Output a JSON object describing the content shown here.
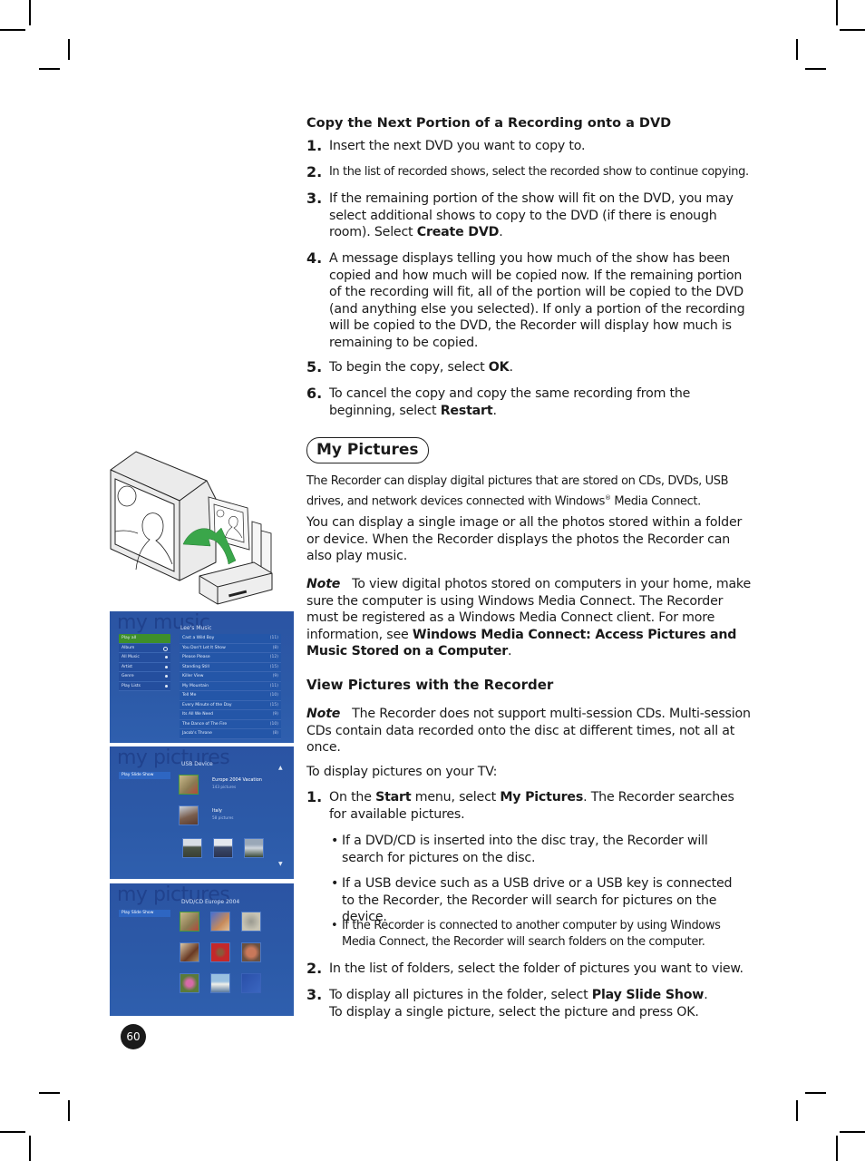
{
  "section1": {
    "heading": "Copy the Next Portion of a Recording onto a DVD",
    "steps": [
      {
        "num": "1.",
        "text": "Insert the next DVD you want to copy to."
      },
      {
        "num": "2.",
        "text": "In the list of recorded shows, select the recorded show to continue copying."
      },
      {
        "num": "3.",
        "text_a": "If the remaining portion of the show will fit on the DVD, you may select additional shows to copy to the DVD (if there is enough room). Select ",
        "bold": "Create DVD",
        "text_b": "."
      },
      {
        "num": "4.",
        "text": "A message displays telling you how much of the show has been copied and how much will be copied now. If the remaining portion of the recording will fit, all of the portion will be copied to the DVD (and anything else you selected). If only a portion of the recording will be copied to the DVD, the Recorder will display how much is remaining to be copied."
      },
      {
        "num": "5.",
        "text_a": "To begin the copy, select ",
        "bold": "OK",
        "text_b": "."
      },
      {
        "num": "6.",
        "text_a": "To cancel the copy and copy the same recording from the beginning, select ",
        "bold": "Restart",
        "text_b": "."
      }
    ]
  },
  "section2": {
    "title": "My Pictures",
    "intro_a": "The Recorder can display digital pictures that are stored on CDs, DVDs, USB drives, and network devices connected with Windows",
    "intro_reg": "®",
    "intro_b": " Media Connect.",
    "para2": "You can display a single image or all the photos stored within a folder or device. When the Recorder displays the photos the Recorder can also play music.",
    "note1_label": "Note",
    "note1_text": "To view digital photos stored on computers in your home, make sure the computer is using Windows Media Connect. The Recorder must be registered as a Windows Media Connect client. For more information, see ",
    "note1_bold": "Windows Media Connect: Access Pictures and Music Stored on a Computer",
    "note1_end": ".",
    "subheading": "View Pictures with the Recorder",
    "note2_label": "Note",
    "note2_text": "The Recorder does not support multi-session CDs. Multi-session CDs contain data recorded onto the disc at different times, not all at once.",
    "lead": "To display pictures on your TV:",
    "step1": {
      "num": "1.",
      "a": "On the ",
      "b1": "Start",
      "c": " menu, select ",
      "b2": "My Pictures",
      "d": ". The Recorder searches for available pictures."
    },
    "bullets": [
      "If a DVD/CD is inserted into the disc tray, the Recorder will search for pictures on the disc.",
      "If a USB device such as a USB drive or a USB key is connected to the Recorder, the Recorder will search for pictures on the device.",
      "If the Recorder is connected to another computer by using Windows Media Connect, the Recorder will search folders on the computer."
    ],
    "step2": {
      "num": "2.",
      "text": "In the list of folders, select the folder of pictures you want to view."
    },
    "step3": {
      "num": "3.",
      "a": "To display all pictures in the folder, select ",
      "bold": "Play Slide Show",
      "b": ".",
      "line2": "To display a single picture, select the picture and press OK."
    }
  },
  "screen_music": {
    "title": "my music",
    "subtitle": "Lee's Music",
    "menu": [
      "Play all",
      "Album",
      "All Music",
      "Artist",
      "Genre",
      "Play Lists"
    ],
    "songs": [
      {
        "name": "Cast a Wild Boy",
        "count": "(11)"
      },
      {
        "name": "You Don't Let It Show",
        "count": "(8)"
      },
      {
        "name": "Please Please",
        "count": "(12)"
      },
      {
        "name": "Standing Still",
        "count": "(15)"
      },
      {
        "name": "Killer View",
        "count": "(9)"
      },
      {
        "name": "My Mountain",
        "count": "(11)"
      },
      {
        "name": "Tell Me",
        "count": "(10)"
      },
      {
        "name": "Every Minute of the Day",
        "count": "(15)"
      },
      {
        "name": "Its All We Need",
        "count": "(9)"
      },
      {
        "name": "The Dance of The Fire",
        "count": "(10)"
      },
      {
        "name": "Jacob's Throne",
        "count": "(8)"
      }
    ]
  },
  "screen_usb": {
    "title": "my pictures",
    "subtitle": "USB Device",
    "menu_button": "Play Slide Show",
    "folders": [
      {
        "name": "Europe 2004 Vacation",
        "count": "143 pictures"
      },
      {
        "name": "Italy",
        "count": "58 pictures"
      }
    ]
  },
  "screen_dvd": {
    "title": "my pictures",
    "subtitle": "DVD/CD Europe 2004",
    "menu_button": "Play Slide Show"
  },
  "page_number": "60",
  "colors": {
    "accent_green": "#3aa64a",
    "screen_blue": "#2c5aa8"
  }
}
